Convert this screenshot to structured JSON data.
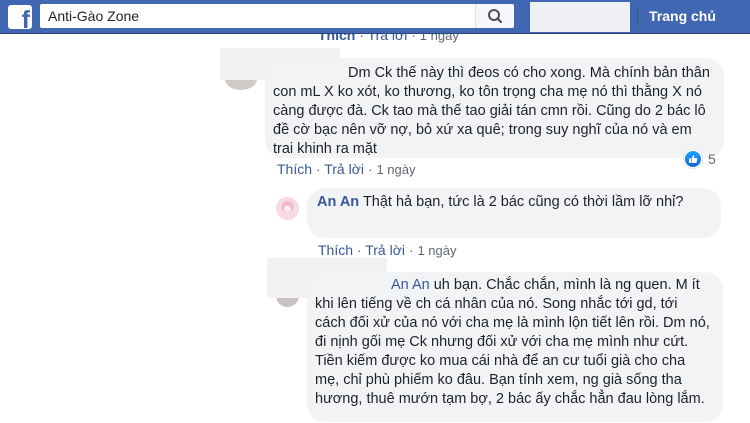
{
  "topbar": {
    "logo_icon": "facebook-logo-icon",
    "logo_letter": "f",
    "search_value": "Anti-Gào Zone",
    "search_icon": "search-icon",
    "home_label": "Trang chủ",
    "colors": {
      "bar": "#4267b2",
      "link": "#385898"
    }
  },
  "comments": [
    {
      "id": "c0",
      "actions": {
        "like": "Thích",
        "reply": "Trả lời",
        "time": "1 ngày"
      }
    },
    {
      "id": "c1",
      "author": "",
      "text": "Dm Ck thế này thì đeos có cho xong. Mà chính bản thân con mL X ko xót, ko thương, ko tôn trọng cha mẹ nó thì thằng X nó càng được đà. Ck tao mà thế tao giải tán cmn rồi. Cũng do 2 bác lô đề cờ bạc nên vỡ nợ, bỏ xứ xa quê; trong suy nghĩ của nó và em trai khinh ra mặt",
      "actions": {
        "like": "Thích",
        "reply": "Trả lời",
        "time": "1 ngày"
      },
      "reaction": {
        "icon": "like-icon",
        "count": "5"
      }
    },
    {
      "id": "c2",
      "author": "An An",
      "text": "Thật hả bạn, tức là 2 bác cũng có thời lầm lỡ nhỉ?",
      "actions": {
        "like": "Thích",
        "reply": "Trả lời",
        "time": "1 ngày"
      }
    },
    {
      "id": "c3",
      "mention": "An An",
      "text": " uh bạn. Chắc chắn, mình là ng quen. M ít khi lên tiếng về ch cá nhân của nó. Song nhắc tới gd, tới cách đối xử của nó với cha mẹ là mình lộn tiết lên rồi. Dm nó, đi nịnh gối mẹ Ck nhưng đối xử với cha mẹ mình như cứt. Tiền kiếm được ko mua cái nhà để an cư tuổi già cho cha mẹ, chỉ phù phiếm ko đâu. Bạn tính xem, ng già sống tha hương, thuê mướn tạm bợ, 2 bác ấy chắc hẳn đau lòng lắm."
    }
  ]
}
